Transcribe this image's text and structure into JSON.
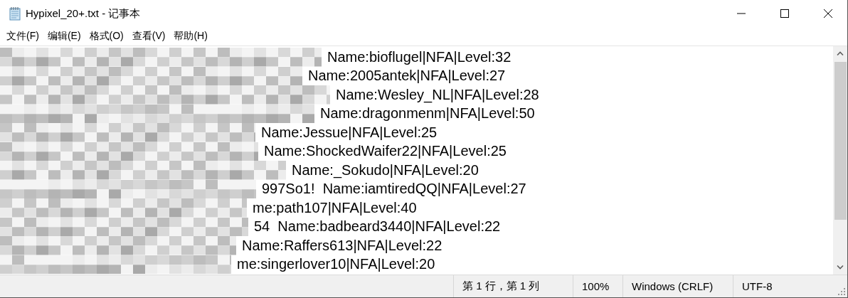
{
  "window": {
    "title": "Hypixel_20+.txt - 记事本"
  },
  "menu": [
    {
      "label": "文件(F)"
    },
    {
      "label": "编辑(E)"
    },
    {
      "label": "格式(O)"
    },
    {
      "label": "查看(V)"
    },
    {
      "label": "帮助(H)"
    }
  ],
  "lines": [
    {
      "text": "Name:bioflugel|NFA|Level:32"
    },
    {
      "text": "Name:2005antek|NFA|Level:27"
    },
    {
      "text": "Name:Wesley_NL|NFA|Level:28"
    },
    {
      "text": "Name:dragonmenm|NFA|Level:50"
    },
    {
      "text": "Name:Jessue|NFA|Level:25"
    },
    {
      "text": "Name:ShockedWaifer22|NFA|Level:25"
    },
    {
      "text": "Name:_Sokudo|NFA|Level:20"
    },
    {
      "text": "997So1!  Name:iamtiredQQ|NFA|Level:27"
    },
    {
      "text": "me:path107|NFA|Level:40"
    },
    {
      "text": "54  Name:badbeard3440|NFA|Level:22"
    },
    {
      "text": "Name:Raffers613|NFA|Level:22"
    },
    {
      "text": "me:singerlover10|NFA|Level:20"
    }
  ],
  "status_bar": {
    "position": "第 1 行，第 1 列",
    "zoom": "100%",
    "line_ending": "Windows (CRLF)",
    "encoding": "UTF-8"
  }
}
